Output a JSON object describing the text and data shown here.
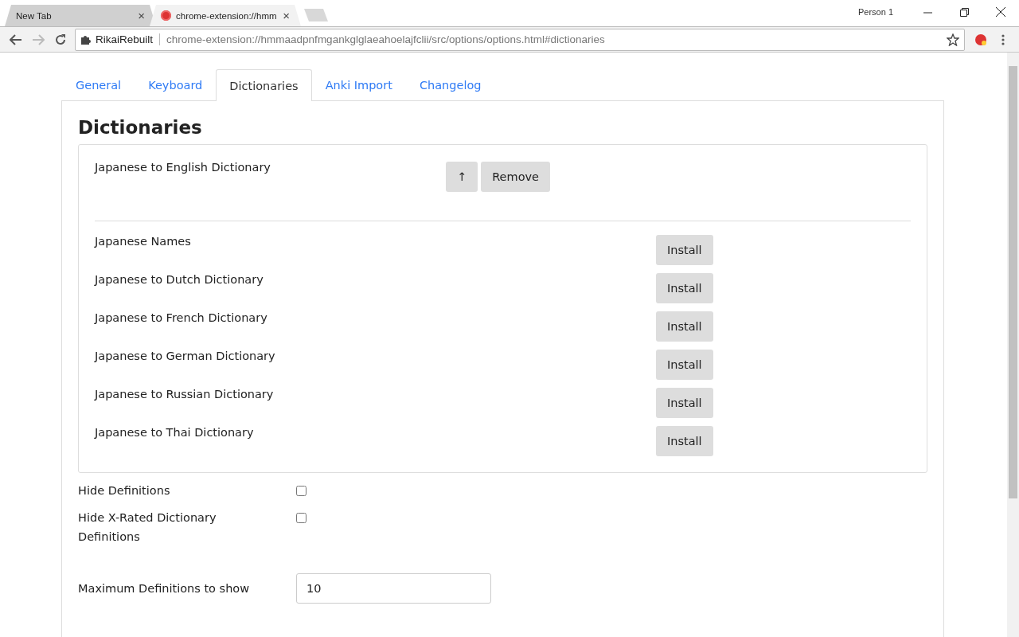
{
  "browser": {
    "tabs": [
      {
        "title": "New Tab",
        "selected": false,
        "close": "×"
      },
      {
        "title": "chrome-extension://hmm",
        "selected": true,
        "close": "×"
      }
    ],
    "profile": "Person 1",
    "site_name": "RikaiRebuilt",
    "url": "chrome-extension://hmmaadpnfmgankglglaeahoelajfclii/src/options/options.html#dictionaries"
  },
  "nav_tabs": [
    {
      "label": "General",
      "selected": false
    },
    {
      "label": "Keyboard",
      "selected": false
    },
    {
      "label": "Dictionaries",
      "selected": true
    },
    {
      "label": "Anki Import",
      "selected": false
    },
    {
      "label": "Changelog",
      "selected": false
    }
  ],
  "heading": "Dictionaries",
  "installed": [
    {
      "name": "Japanese to English Dictionary",
      "up": "↑",
      "remove": "Remove"
    }
  ],
  "available": [
    {
      "name": "Japanese Names",
      "action": "Install"
    },
    {
      "name": "Japanese to Dutch Dictionary",
      "action": "Install"
    },
    {
      "name": "Japanese to French Dictionary",
      "action": "Install"
    },
    {
      "name": "Japanese to German Dictionary",
      "action": "Install"
    },
    {
      "name": "Japanese to Russian Dictionary",
      "action": "Install"
    },
    {
      "name": "Japanese to Thai Dictionary",
      "action": "Install"
    }
  ],
  "settings": [
    {
      "kind": "checkbox",
      "label": "Hide Definitions",
      "checked": false
    },
    {
      "kind": "checkbox",
      "label": "Hide X-Rated Dictionary Definitions",
      "checked": false
    },
    {
      "kind": "number",
      "label": "Maximum Definitions to show",
      "value": "10"
    }
  ]
}
